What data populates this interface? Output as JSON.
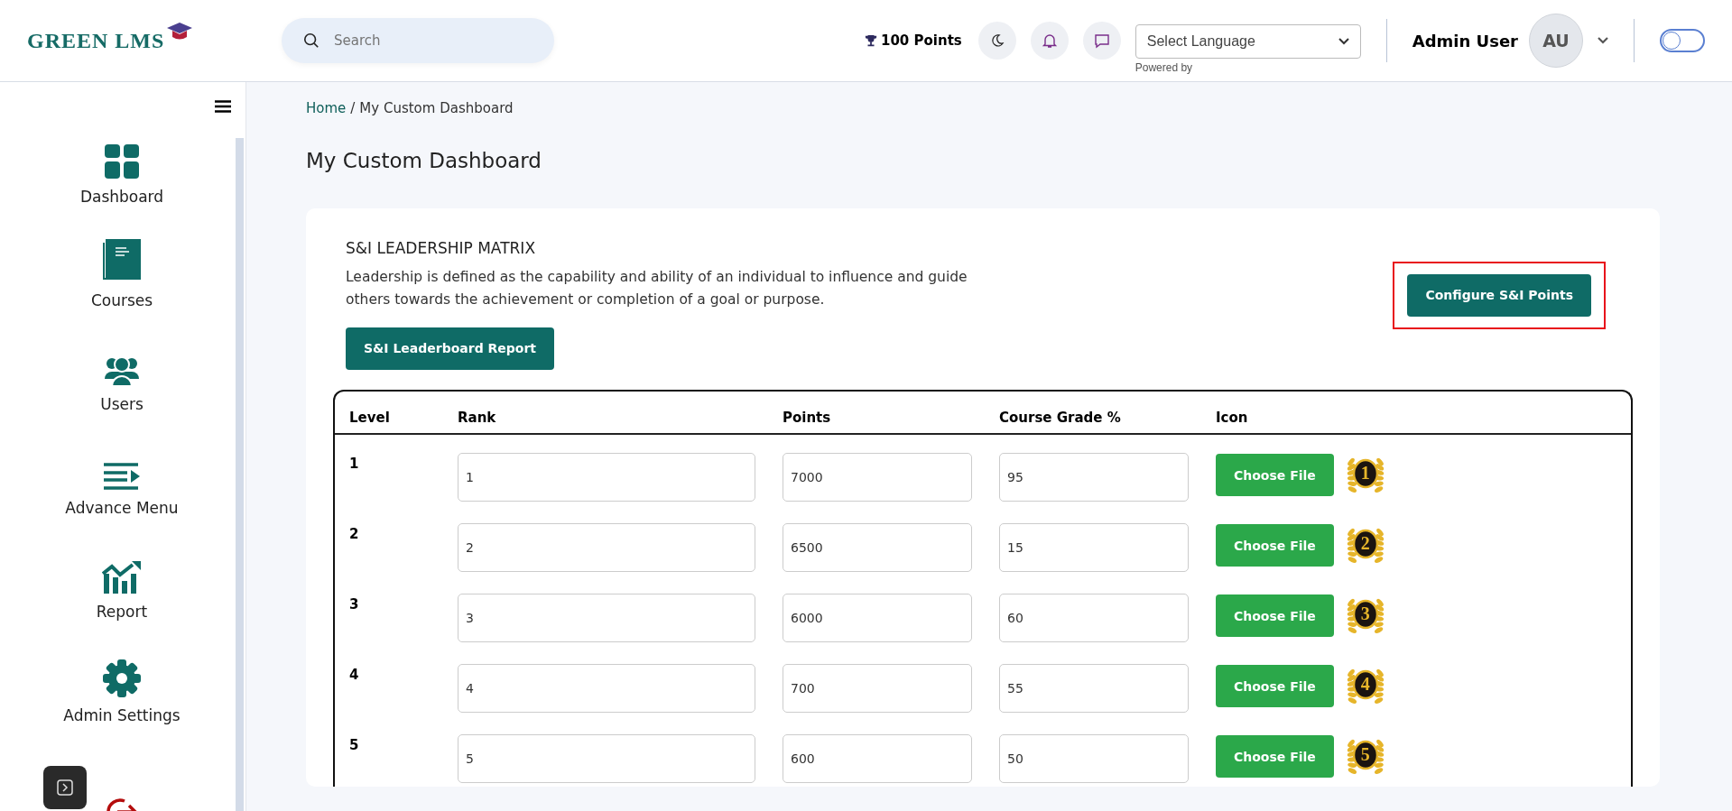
{
  "header": {
    "logo": "GREEN LMS",
    "search": {
      "placeholder": "Search"
    },
    "points": "100 Points",
    "language": {
      "value": "Select Language",
      "note": "Powered by"
    },
    "user": {
      "name": "Admin User",
      "initials": "AU"
    },
    "toggle": {
      "on": false
    }
  },
  "sidebar": {
    "items": [
      {
        "label": "Dashboard",
        "kind": "grid"
      },
      {
        "label": "Courses",
        "kind": "book"
      },
      {
        "label": "Users",
        "kind": "users"
      },
      {
        "label": "Advance Menu",
        "kind": "menu"
      },
      {
        "label": "Report",
        "kind": "chart"
      },
      {
        "label": "Admin Settings",
        "kind": "gear"
      },
      {
        "kind": "logout"
      }
    ]
  },
  "breadcrumb": {
    "separator": "/",
    "items": [
      {
        "label": "Home",
        "link": true
      },
      {
        "label": "My Custom Dashboard",
        "link": false
      }
    ]
  },
  "page_title": "My Custom Dashboard",
  "card": {
    "title": "S&I LEADERSHIP MATRIX",
    "description": "Leadership is defined as the capability and ability of an individual to influence and guide others towards the achievement or completion of a goal or purpose.",
    "report_button": "S&I Leaderboard Report",
    "configure_button": {
      "label": "Configure S&I Points",
      "highlighted": true
    }
  },
  "table": {
    "columns": [
      "Level",
      "Rank",
      "Points",
      "Course Grade %",
      "Icon"
    ],
    "rows": [
      {
        "level": "1",
        "rank": "1",
        "points": "7000",
        "grade": "95",
        "button": "Choose File",
        "medal": "1"
      },
      {
        "level": "2",
        "rank": "2",
        "points": "6500",
        "grade": "15",
        "button": "Choose File",
        "medal": "2"
      },
      {
        "level": "3",
        "rank": "3",
        "points": "6000",
        "grade": "60",
        "button": "Choose File",
        "medal": "3"
      },
      {
        "level": "4",
        "rank": "4",
        "points": "700",
        "grade": "55",
        "button": "Choose File",
        "medal": "4"
      },
      {
        "level": "5",
        "rank": "5",
        "points": "600",
        "grade": "50",
        "button": "Choose File",
        "medal": "5"
      }
    ]
  }
}
